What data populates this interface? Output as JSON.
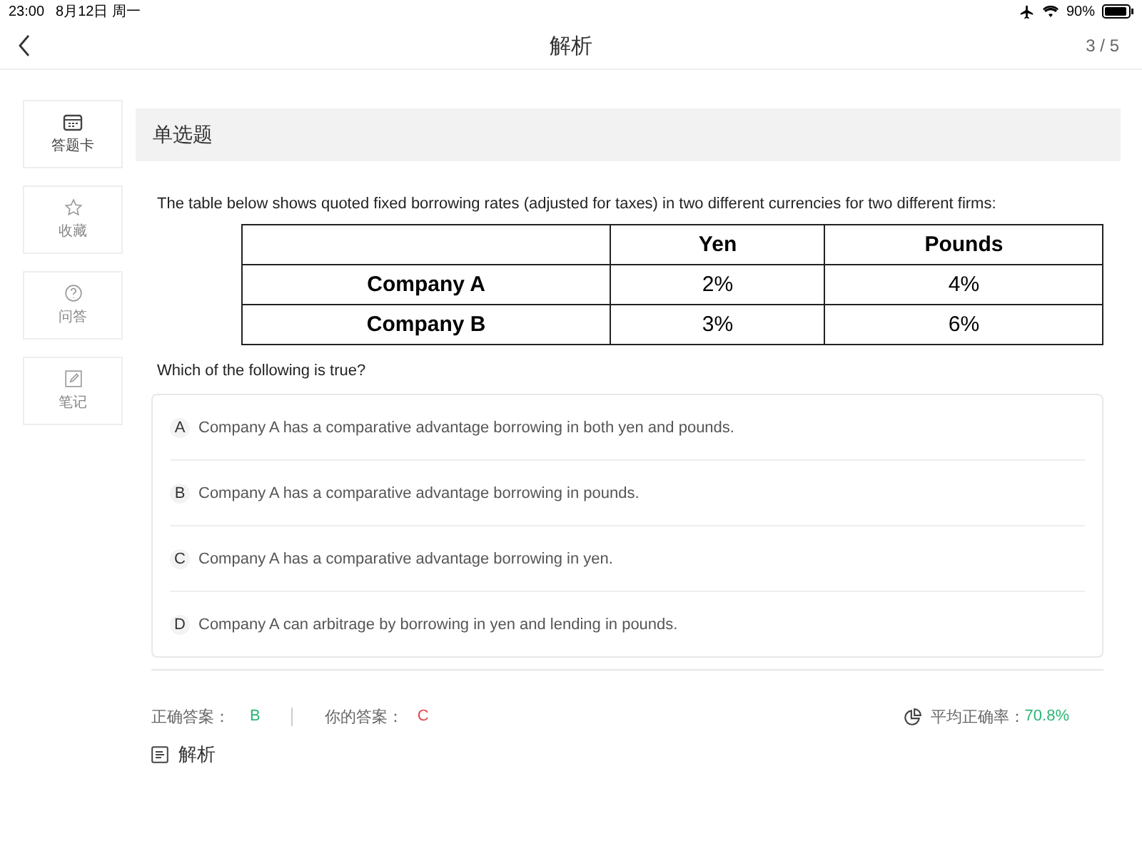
{
  "status_bar": {
    "time": "23:00",
    "date": "8月12日 周一",
    "battery": "90%"
  },
  "header": {
    "title": "解析",
    "progress": "3 / 5"
  },
  "sidebar": {
    "items": [
      {
        "label": "答题卡"
      },
      {
        "label": "收藏"
      },
      {
        "label": "问答"
      },
      {
        "label": "笔记"
      }
    ]
  },
  "question": {
    "type": "单选题",
    "stem": "The table below shows quoted fixed borrowing rates (adjusted for taxes) in two different currencies for two different firms:",
    "table": {
      "columns": [
        "",
        "Yen",
        "Pounds"
      ],
      "rows": [
        [
          "Company A",
          "2%",
          "4%"
        ],
        [
          "Company B",
          "3%",
          "6%"
        ]
      ]
    },
    "prompt": "Which of the following is true?",
    "options": [
      {
        "letter": "A",
        "text": "Company A has a comparative advantage borrowing in both yen and pounds."
      },
      {
        "letter": "B",
        "text": "Company A has a comparative advantage borrowing in pounds."
      },
      {
        "letter": "C",
        "text": "Company A has a comparative advantage borrowing in yen."
      },
      {
        "letter": "D",
        "text": "Company A can arbitrage by borrowing in yen and lending in pounds."
      }
    ]
  },
  "result": {
    "correct_label": "正确答案：",
    "correct": "B",
    "yours_label": "你的答案：",
    "yours": "C",
    "rate_label": "平均正确率：",
    "rate": "70.8%"
  },
  "analysis": {
    "title": "解析"
  }
}
